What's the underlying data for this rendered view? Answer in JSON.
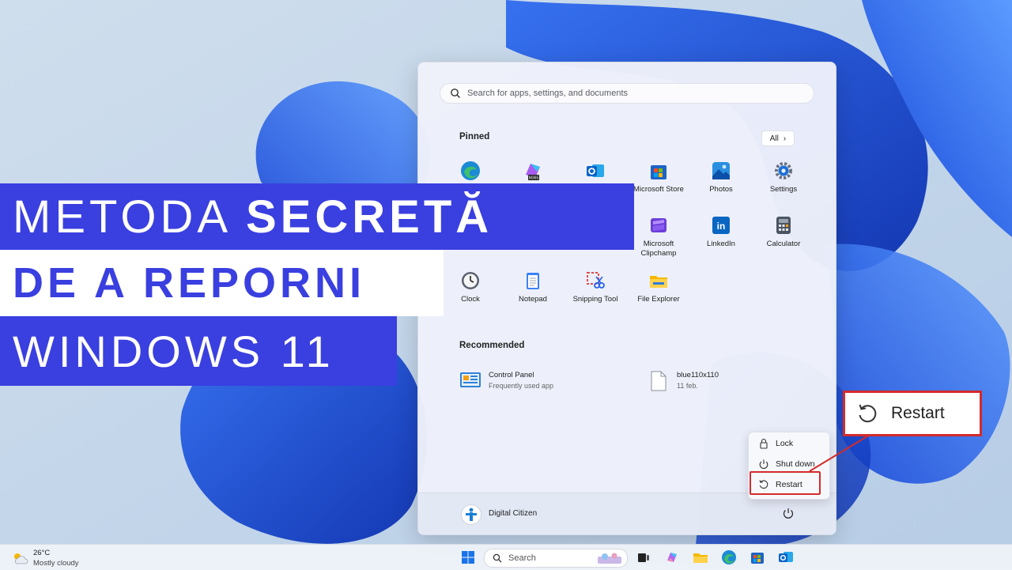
{
  "start_menu": {
    "search_placeholder": "Search for apps, settings, and documents",
    "pinned_title": "Pinned",
    "all_button": "All",
    "pinned_apps_row1": [
      {
        "label": "",
        "icon": "edge-icon"
      },
      {
        "label": "",
        "icon": "m365-copilot-icon",
        "badge": "M365"
      },
      {
        "label": "",
        "icon": "outlook-icon"
      },
      {
        "label": "Microsoft Store",
        "icon": "store-icon"
      },
      {
        "label": "Photos",
        "icon": "photos-icon"
      },
      {
        "label": "Settings",
        "icon": "settings-icon"
      }
    ],
    "pinned_apps_row2": [
      {
        "label": "Microsoft\nClipchamp",
        "icon": "clipchamp-icon"
      },
      {
        "label": "LinkedIn",
        "icon": "linkedin-icon"
      },
      {
        "label": "Calculator",
        "icon": "calculator-icon"
      }
    ],
    "pinned_apps_row3": [
      {
        "label": "Clock",
        "icon": "clock-icon"
      },
      {
        "label": "Notepad",
        "icon": "notepad-icon"
      },
      {
        "label": "Snipping Tool",
        "icon": "snipping-tool-icon"
      },
      {
        "label": "File Explorer",
        "icon": "file-explorer-icon"
      }
    ],
    "recommended_title": "Recommended",
    "recommended": [
      {
        "title": "Control Panel",
        "subtitle": "Frequently used app",
        "icon": "control-panel-icon"
      },
      {
        "title": "blue110x110",
        "subtitle": "11 feb.",
        "icon": "file-icon"
      }
    ],
    "user_name": "Digital Citizen"
  },
  "power_menu": {
    "items": [
      "Lock",
      "Shut down",
      "Restart"
    ]
  },
  "callout": {
    "label": "Restart"
  },
  "banner": {
    "line1_regular": "METODA ",
    "line1_bold": "SECRETĂ",
    "line2": "DE A REPORNI",
    "line3": "WINDOWS 11"
  },
  "taskbar": {
    "weather_temp": "26°C",
    "weather_desc": "Mostly cloudy",
    "search_label": "Search"
  },
  "colors": {
    "banner_blue": "#3a3fe0",
    "highlight_red": "#d42b2b"
  }
}
